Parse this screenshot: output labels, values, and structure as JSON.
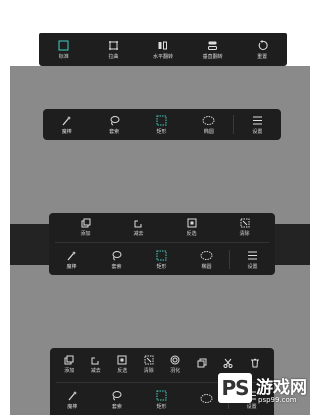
{
  "colors": {
    "accent": "#3fd1c0",
    "toolbar_bg": "#1e1e1e",
    "canvas_gray": "#8a8a8a",
    "dark_band": "#232323"
  },
  "top_toolbar": {
    "items": [
      {
        "label": "标准",
        "icon": "crop-square-icon"
      },
      {
        "label": "拉曲",
        "icon": "perspective-icon"
      },
      {
        "label": "水平翻转",
        "icon": "flip-horizontal-icon"
      },
      {
        "label": "垂直翻转",
        "icon": "flip-vertical-icon"
      },
      {
        "label": "重置",
        "icon": "reset-icon"
      }
    ]
  },
  "selection_toolbar_1": {
    "items": [
      {
        "label": "魔棒",
        "icon": "magic-wand-icon"
      },
      {
        "label": "套索",
        "icon": "lasso-icon"
      },
      {
        "label": "矩形",
        "icon": "rect-select-icon"
      },
      {
        "label": "椭圆",
        "icon": "ellipse-select-icon"
      },
      {
        "label": "设置",
        "icon": "menu-icon"
      }
    ]
  },
  "panel_2": {
    "ops": [
      {
        "label": "添加",
        "icon": "add-selection-icon"
      },
      {
        "label": "减去",
        "icon": "subtract-selection-icon"
      },
      {
        "label": "反选",
        "icon": "invert-selection-icon"
      },
      {
        "label": "清除",
        "icon": "clear-selection-icon"
      }
    ],
    "tools": [
      {
        "label": "魔棒",
        "icon": "magic-wand-icon"
      },
      {
        "label": "套索",
        "icon": "lasso-icon"
      },
      {
        "label": "矩形",
        "icon": "rect-select-icon"
      },
      {
        "label": "椭圆",
        "icon": "ellipse-select-icon"
      },
      {
        "label": "设置",
        "icon": "menu-icon"
      }
    ]
  },
  "panel_3": {
    "ops": [
      {
        "label": "添加",
        "icon": "add-selection-icon"
      },
      {
        "label": "减去",
        "icon": "subtract-selection-icon"
      },
      {
        "label": "反选",
        "icon": "invert-selection-icon"
      },
      {
        "label": "清除",
        "icon": "clear-selection-icon"
      },
      {
        "label": "羽化",
        "icon": "feather-icon"
      },
      {
        "label": "",
        "icon": "copy-icon"
      },
      {
        "label": "",
        "icon": "cut-icon"
      },
      {
        "label": "",
        "icon": "trash-icon"
      }
    ],
    "tools": [
      {
        "label": "魔棒",
        "icon": "magic-wand-icon"
      },
      {
        "label": "套索",
        "icon": "lasso-icon"
      },
      {
        "label": "矩形",
        "icon": "rect-select-icon"
      },
      {
        "label": "",
        "icon": "ellipse-select-icon"
      },
      {
        "label": "设置",
        "icon": "menu-icon"
      }
    ]
  },
  "watermark": {
    "logo": "PS",
    "site": "游戏网",
    "url": "psp99.com"
  }
}
